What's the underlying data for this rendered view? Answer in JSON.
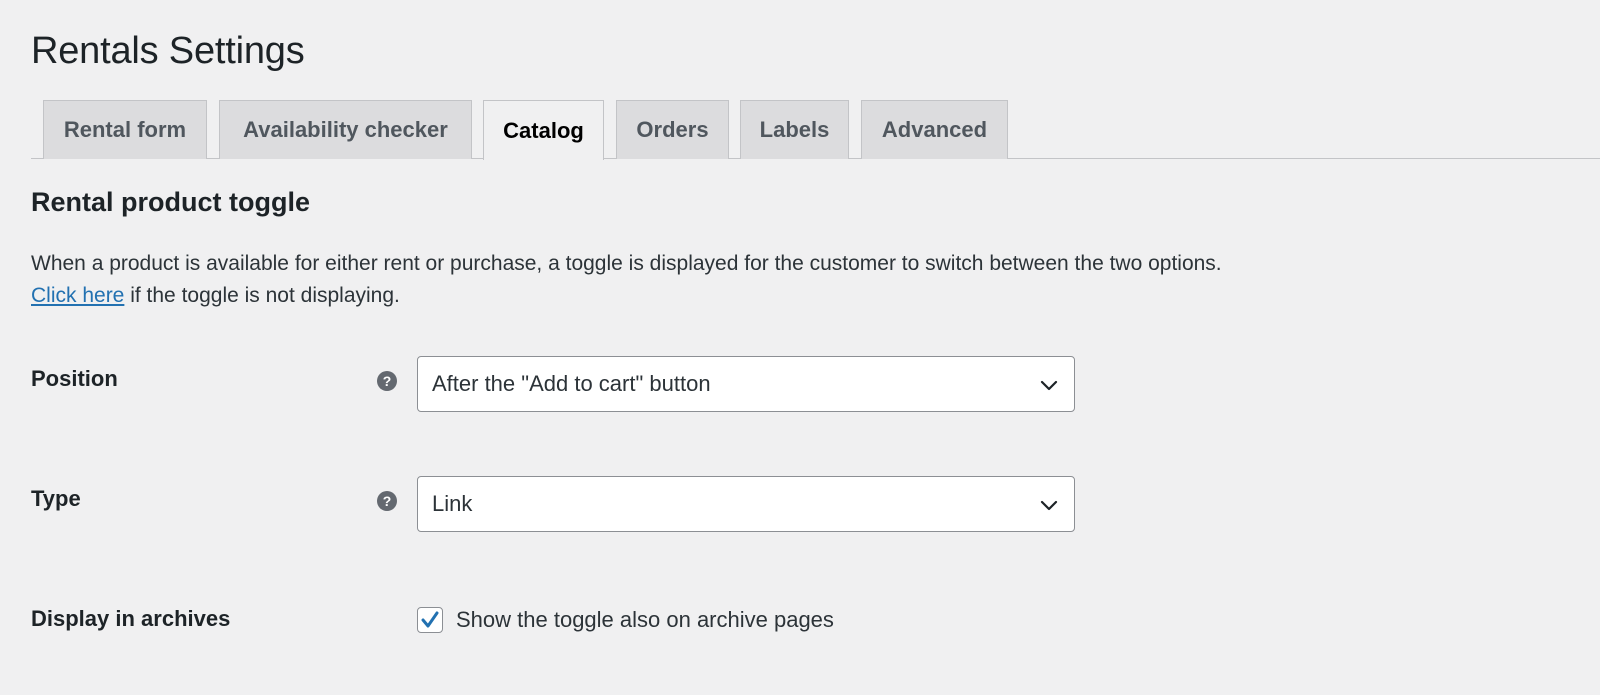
{
  "page": {
    "title": "Rentals Settings"
  },
  "tabs": [
    {
      "label": "Rental form",
      "active": false
    },
    {
      "label": "Availability checker",
      "active": false
    },
    {
      "label": "Catalog",
      "active": true
    },
    {
      "label": "Orders",
      "active": false
    },
    {
      "label": "Labels",
      "active": false
    },
    {
      "label": "Advanced",
      "active": false
    }
  ],
  "section": {
    "title": "Rental product toggle",
    "description": "When a product is available for either rent or purchase, a toggle is displayed for the customer to switch between the two options.",
    "link_text": "Click here",
    "link_suffix": " if the toggle is not displaying."
  },
  "fields": {
    "position": {
      "label": "Position",
      "help_icon": "question-circle-icon",
      "value": "After the \"Add to cart\" button"
    },
    "type": {
      "label": "Type",
      "help_icon": "question-circle-icon",
      "value": "Link"
    },
    "archives": {
      "label": "Display in archives",
      "checkbox_label": "Show the toggle also on archive pages",
      "checked": true
    }
  },
  "colors": {
    "background": "#f0f0f1",
    "link": "#2271b1",
    "tab_inactive": "#dcdcde",
    "checkmark": "#2271b1"
  }
}
